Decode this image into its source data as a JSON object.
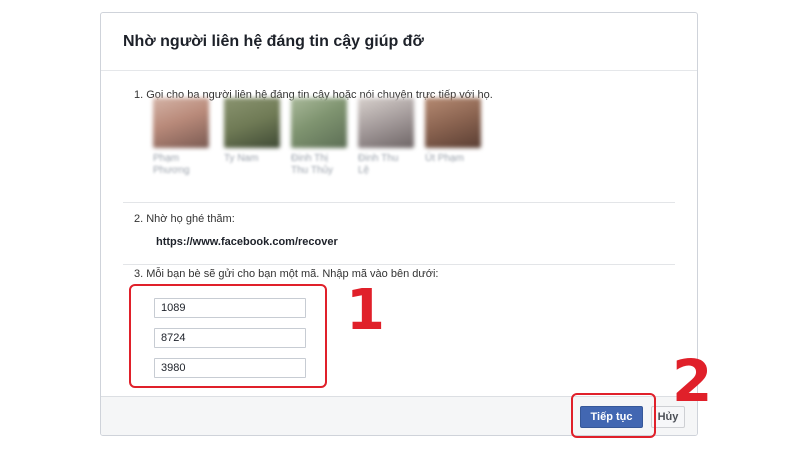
{
  "dialog": {
    "title": "Nhờ người liên hệ đáng tin cậy giúp đỡ",
    "step1": "1. Gọi cho ba người liên hệ đáng tin cậy hoặc nói chuyện trực tiếp với họ.",
    "contacts": [
      {
        "name": "Phạm\nPhương",
        "color": "#b98a7a"
      },
      {
        "name": "Ty Nam",
        "color": "#6f7a55"
      },
      {
        "name": "Đinh Thị\nThu Thủy",
        "color": "#7f9470"
      },
      {
        "name": "Đinh Thu\nLệ",
        "color": "#a39a9a"
      },
      {
        "name": "Út Phạm",
        "color": "#8a6350"
      }
    ],
    "step2": "2. Nhờ họ ghé thăm:",
    "recover_url": "https://www.facebook.com/recover",
    "step3": "3. Mỗi bạn bè sẽ gửi cho bạn một mã. Nhập mã vào bên dưới:",
    "codes": [
      "1089",
      "8724",
      "3980"
    ],
    "continue_label": "Tiếp tục",
    "cancel_label": "Hủy"
  },
  "annotations": {
    "label1": "1",
    "label2": "2",
    "color": "#e0202a"
  }
}
